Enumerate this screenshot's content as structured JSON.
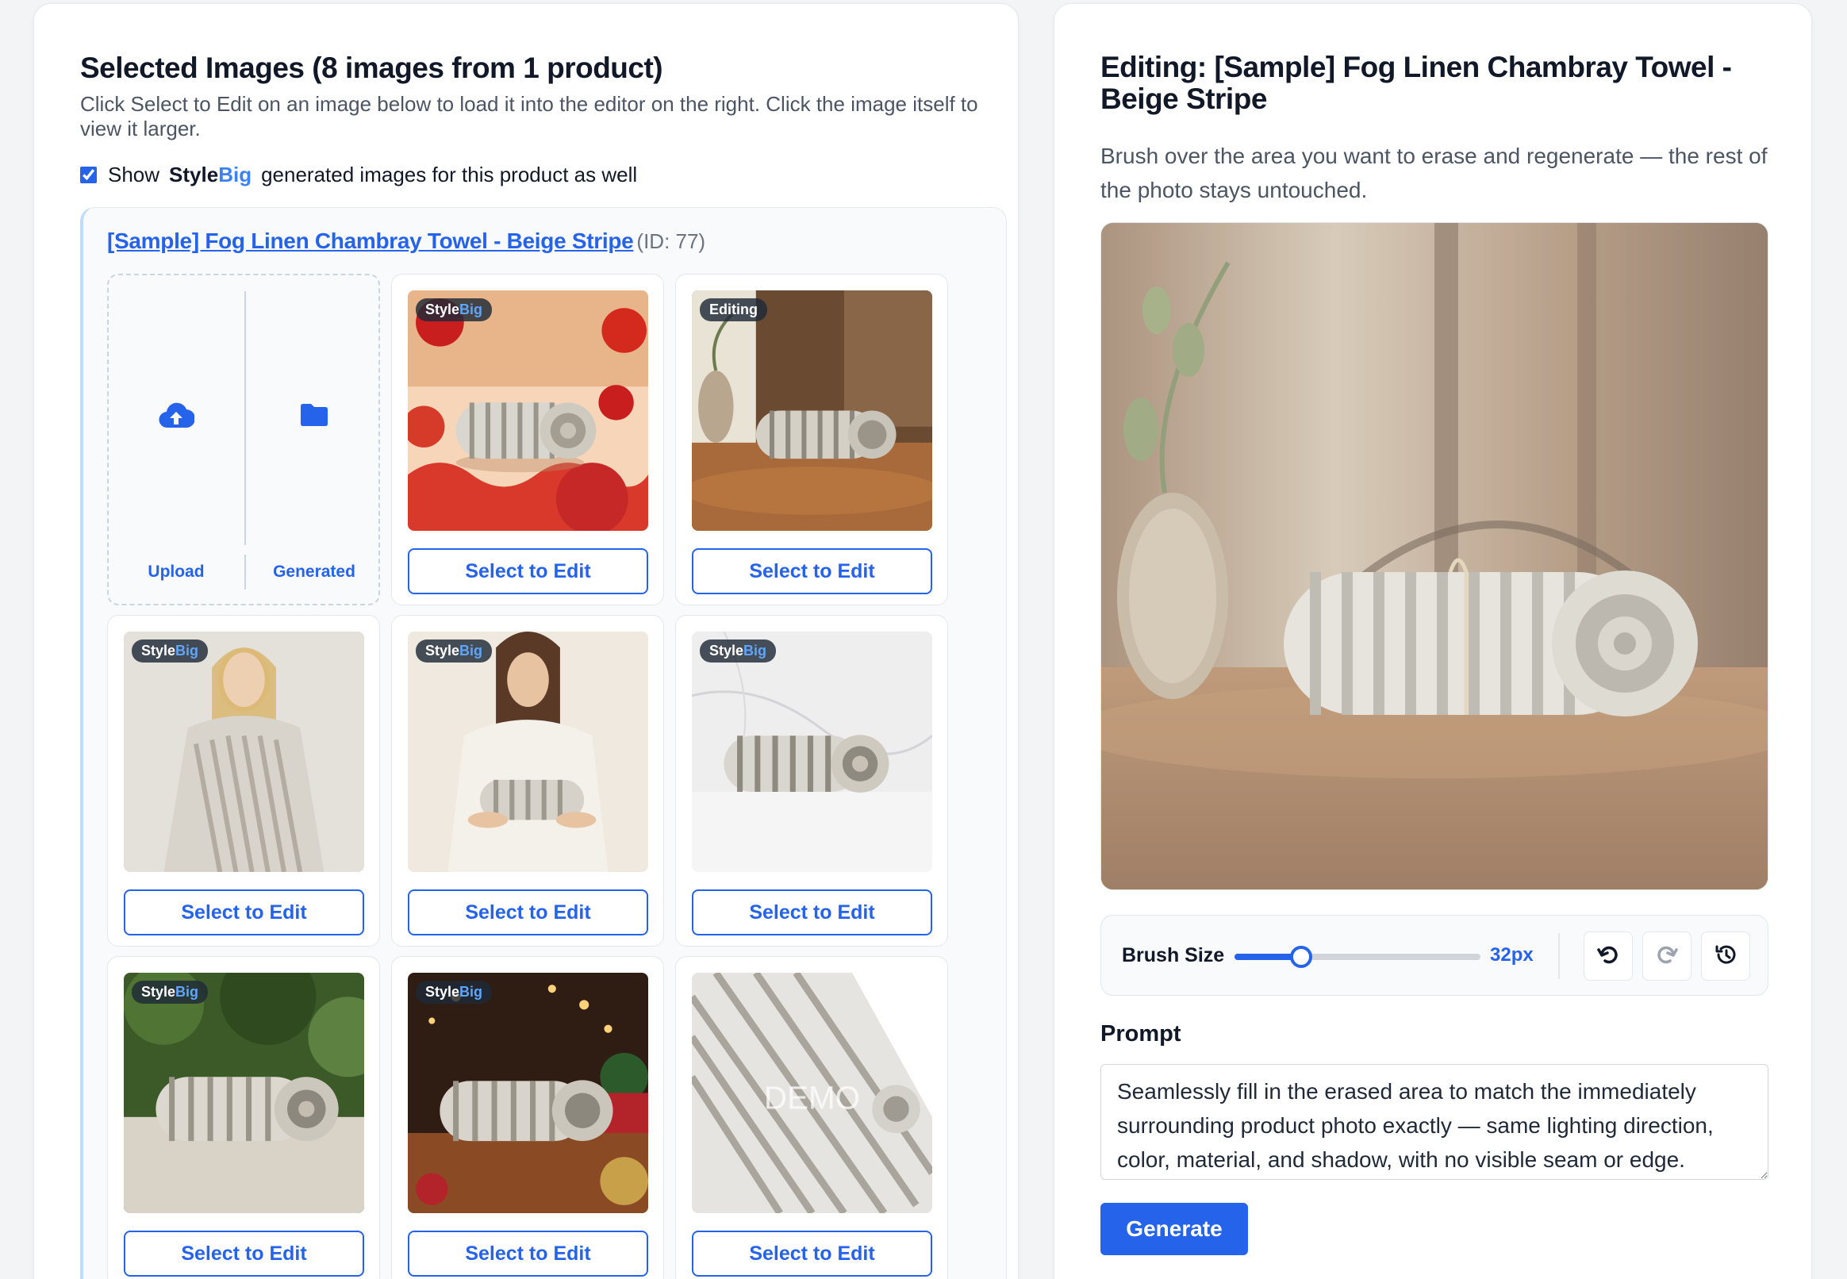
{
  "left": {
    "title": "Selected Images (8 images from 1 product)",
    "description": "Click Select to Edit on an image below to load it into the editor on the right. Click the image itself to view it larger.",
    "show_checkbox_checked": true,
    "show_prefix": "Show",
    "brand_style": "Style",
    "brand_big": "Big",
    "show_suffix": "generated images for this product as well"
  },
  "product": {
    "name": "[Sample] Fog Linen Chambray Towel - Beige Stripe",
    "id_label": "(ID: 77)"
  },
  "upload_card": {
    "upload_label": "Upload",
    "generated_label": "Generated",
    "upload_icon": "cloud-upload-icon",
    "generated_icon": "folder-icon"
  },
  "cards": [
    {
      "badge_style": "Style",
      "badge_big": "Big",
      "button": "Select to Edit",
      "scene": "lunar-new-year"
    },
    {
      "badge_text": "Editing",
      "button": "Select to Edit",
      "scene": "cafe-table"
    },
    {
      "badge_style": "Style",
      "badge_big": "Big",
      "button": "Select to Edit",
      "scene": "woman-wrap"
    },
    {
      "badge_style": "Style",
      "badge_big": "Big",
      "button": "Select to Edit",
      "scene": "woman-holding"
    },
    {
      "badge_style": "Style",
      "badge_big": "Big",
      "button": "Select to Edit",
      "scene": "marble"
    },
    {
      "badge_style": "Style",
      "badge_big": "Big",
      "button": "Select to Edit",
      "scene": "garden"
    },
    {
      "badge_style": "Style",
      "badge_big": "Big",
      "button": "Select to Edit",
      "scene": "christmas"
    },
    {
      "watermark": "DEMO",
      "button": "Select to Edit",
      "scene": "closeup"
    }
  ],
  "right": {
    "title": "Editing: [Sample] Fog Linen Chambray Towel - Beige Stripe",
    "description": "Brush over the area you want to erase and regenerate — the rest of the photo stays untouched.",
    "brush_label": "Brush Size",
    "brush_value": "32px",
    "brush_fraction": 0.27,
    "undo_icon": "undo-icon",
    "redo_icon": "redo-icon",
    "history_icon": "history-icon",
    "prompt_label": "Prompt",
    "prompt_value": "Seamlessly fill in the erased area to match the immediately surrounding product photo exactly — same lighting direction, color, material, and shadow, with no visible seam or edge.",
    "generate_label": "Generate"
  },
  "colors": {
    "accent": "#2563eb",
    "brand_big": "#60a5fa"
  }
}
